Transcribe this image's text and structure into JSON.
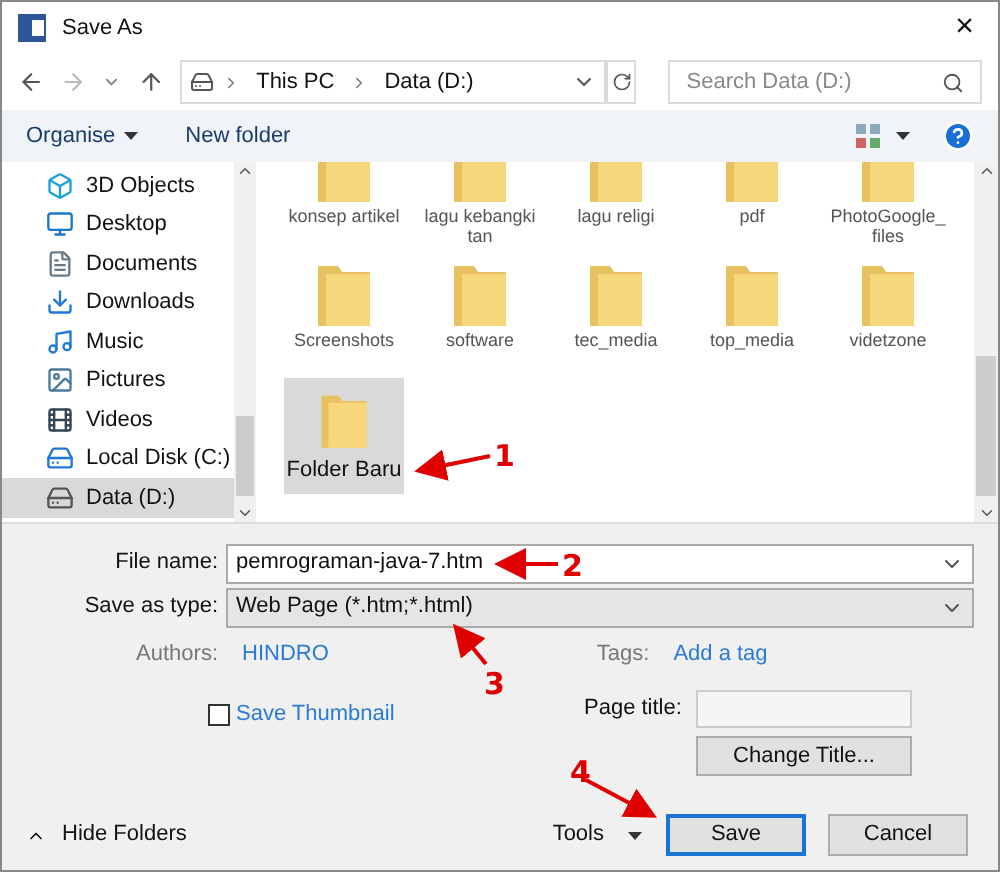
{
  "window": {
    "title": "Save As",
    "close": "×"
  },
  "address": {
    "path": [
      "This PC",
      "Data (D:)"
    ],
    "search_placeholder": "Search Data (D:)"
  },
  "toolbar": {
    "organise": "Organise",
    "new_folder": "New folder"
  },
  "sidebar": {
    "items": [
      {
        "label": "3D Objects",
        "selected": false
      },
      {
        "label": "Desktop",
        "selected": false
      },
      {
        "label": "Documents",
        "selected": false
      },
      {
        "label": "Downloads",
        "selected": false
      },
      {
        "label": "Music",
        "selected": false
      },
      {
        "label": "Pictures",
        "selected": false
      },
      {
        "label": "Videos",
        "selected": false
      },
      {
        "label": "Local Disk (C:)",
        "selected": false
      },
      {
        "label": "Data (D:)",
        "selected": true
      }
    ]
  },
  "files": [
    {
      "name": "konsep artikel",
      "selected": false
    },
    {
      "name": "lagu kebangkitan",
      "selected": false
    },
    {
      "name": "lagu religi",
      "selected": false
    },
    {
      "name": "pdf",
      "selected": false
    },
    {
      "name": "PhotoGoogle_files",
      "selected": false
    },
    {
      "name": "Screenshots",
      "selected": false
    },
    {
      "name": "software",
      "selected": false
    },
    {
      "name": "tec_media",
      "selected": false
    },
    {
      "name": "top_media",
      "selected": false
    },
    {
      "name": "videtzone",
      "selected": false
    },
    {
      "name": "Folder Baru",
      "selected": true
    }
  ],
  "form": {
    "file_name_label": "File name:",
    "file_name": "pemrograman-java-7.htm",
    "type_label": "Save as type:",
    "type": "Web Page (*.htm;*.html)",
    "authors_label": "Authors:",
    "authors": "HINDRO",
    "tags_label": "Tags:",
    "tags": "Add a tag",
    "thumbnail": {
      "label": "Save Thumbnail",
      "checked": false
    },
    "page_title_label": "Page title:",
    "change_title": "Change Title..."
  },
  "footer": {
    "hide_folders": "Hide Folders",
    "tools": "Tools",
    "save": "Save",
    "cancel": "Cancel"
  },
  "annotations": [
    {
      "label": "1"
    },
    {
      "label": "2"
    },
    {
      "label": "3"
    },
    {
      "label": "4"
    }
  ]
}
